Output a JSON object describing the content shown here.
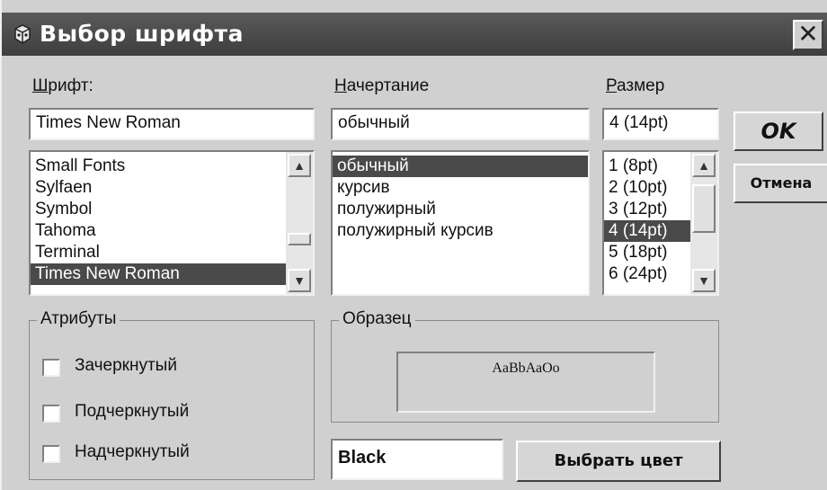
{
  "window": {
    "title": "Выбор шрифта",
    "close_glyph": "✕"
  },
  "font": {
    "label_hotkey": "Ш",
    "label_rest": "рифт:",
    "value": "Times New Roman",
    "items": [
      "Small Fonts",
      "Sylfaen",
      "Symbol",
      "Tahoma",
      "Terminal",
      "Times New Roman"
    ],
    "selected_index": 5
  },
  "style": {
    "label_hotkey": "Н",
    "label_rest": "ачертание",
    "value": "обычный",
    "items": [
      "обычный",
      "курсив",
      "полужирный",
      "полужирный курсив"
    ],
    "selected_index": 0
  },
  "size": {
    "label_hotkey": "Р",
    "label_rest": "азмер",
    "value": "4 (14pt)",
    "items": [
      "1 (8pt)",
      "2 (10pt)",
      "3 (12pt)",
      "4 (14pt)",
      "5 (18pt)",
      "6 (24pt)"
    ],
    "selected_index": 3
  },
  "attributes": {
    "legend": "Атрибуты",
    "strikethrough": {
      "label": "Зачеркнутый",
      "checked": false
    },
    "underline": {
      "label": "Подчеркнутый",
      "checked": false
    },
    "overline": {
      "label": "Надчеркнутый",
      "checked": false
    }
  },
  "sample": {
    "legend": "Образец",
    "text": "AaBbАаОо"
  },
  "color": {
    "value": "Black",
    "choose_label": "Выбрать цвет"
  },
  "buttons": {
    "ok": "OK",
    "cancel": "Отмена"
  }
}
